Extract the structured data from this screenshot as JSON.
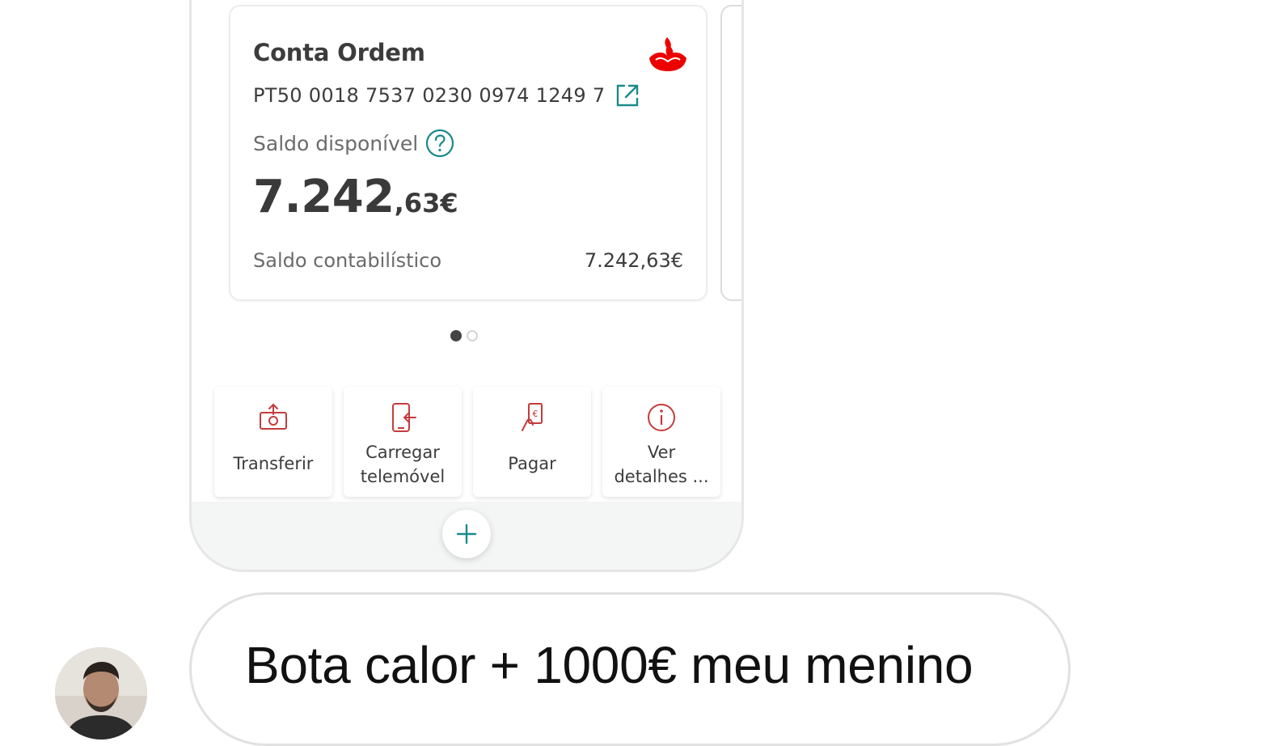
{
  "account": {
    "name": "Conta Ordem",
    "iban": "PT50 0018 7537 0230 0974 1249 7",
    "available_label": "Saldo disponível",
    "available_integer": "7.242",
    "available_decimal": ",63€",
    "accounting_label": "Saldo contabilístico",
    "accounting_value": "7.242,63€"
  },
  "pagination": {
    "current": 1,
    "total": 2
  },
  "actions": [
    {
      "label": "Transferir",
      "icon": "transfer-icon"
    },
    {
      "label": "Carregar\ntelemóvel",
      "icon": "phone-topup-icon"
    },
    {
      "label": "Pagar",
      "icon": "pay-icon"
    },
    {
      "label": "Ver\ndetalhes ...",
      "icon": "info-icon"
    }
  ],
  "message": {
    "text": "Bota calor + 1000€ meu menino"
  },
  "colors": {
    "brand_red": "#ec0000",
    "accent_teal": "#1a8a8a",
    "icon_red": "#c63b3b"
  }
}
